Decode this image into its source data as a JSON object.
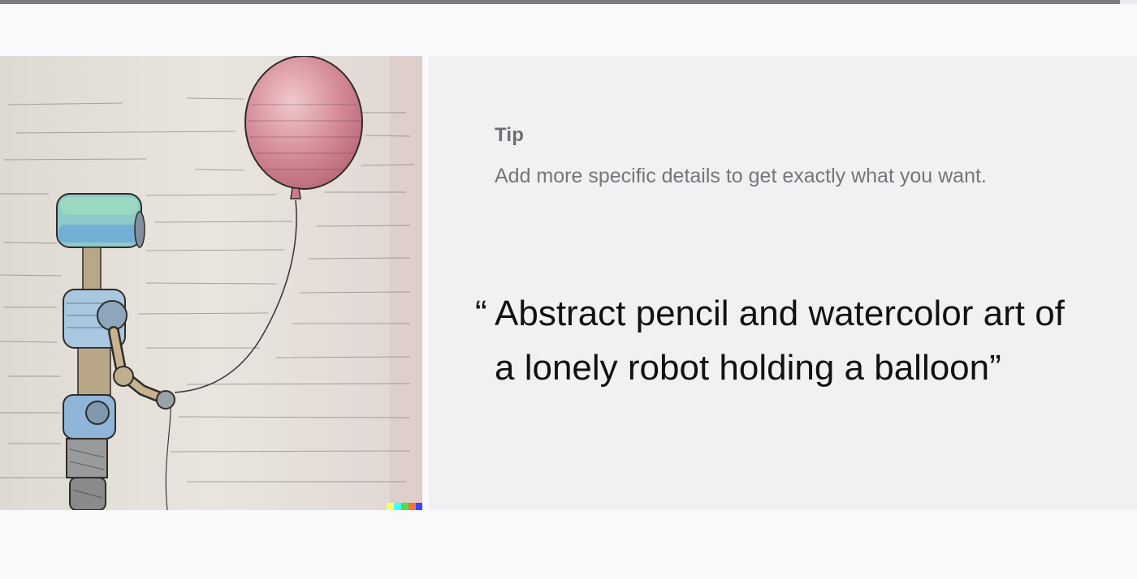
{
  "progress": {
    "fraction": 0.985,
    "color": "#7a7a80"
  },
  "artwork": {
    "alt": "Abstract pencil and watercolor art of a lonely robot holding a balloon"
  },
  "tip": {
    "label": "Tip",
    "text": "Add more specific details to get exactly what you want."
  },
  "prompt": {
    "open_quote": "“",
    "text": "Abstract pencil and watercolor art of a lonely robot holding a balloon",
    "close_quote": "”"
  }
}
